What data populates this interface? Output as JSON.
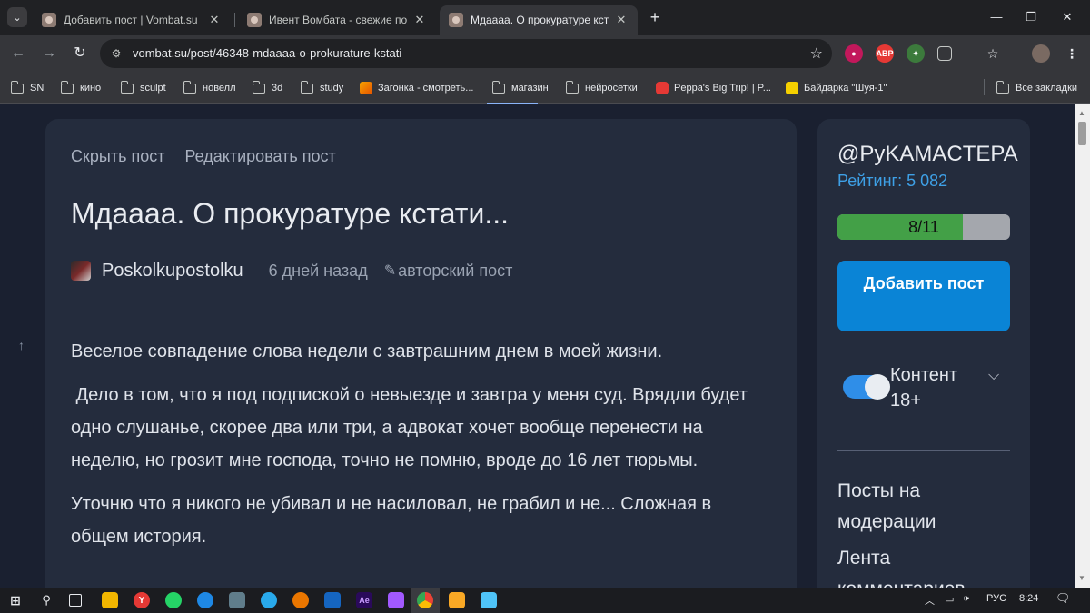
{
  "browser": {
    "tabs": [
      {
        "title": "Добавить пост | Vombat.su",
        "active": false
      },
      {
        "title": "Ивент Вомбата - свежие посты",
        "active": false
      },
      {
        "title": "Мдаааа. О прокуратуре кстати",
        "active": true
      }
    ],
    "url": "vombat.su/post/46348-mdaaaa-o-prokurature-kstati",
    "bookmarks": [
      "SN",
      "кино",
      "sculpt",
      "новелл",
      "3d",
      "study",
      "Загонка - смотреть...",
      "магазин",
      "нейросетки",
      "Peppa's Big Trip! | P...",
      "Байдарка \"Шуя-1\""
    ],
    "all_bookmarks": "Все закладки",
    "extensions": {
      "abp": "ABP"
    }
  },
  "post": {
    "hide_label": "Скрыть пост",
    "edit_label": "Редактировать пост",
    "title": "Мдаааа. О прокуратуре кстати...",
    "author": "Poskolkupostolku",
    "time": "6 дней назад",
    "kind": "авторский пост",
    "paragraphs": [
      "Веселое совпадение слова недели с завтрашним днем в моей жизни.",
      " Дело в том, что я под подпиской о невыезде и завтра у меня суд. Врядли будет одно слушанье, скорее два или три, а адвокат хочет вообще перенести на неделю, но грозит мне господа, точно не помню, вроде до 16 лет тюрьмы.",
      "Уточню что я никого не убивал и не насиловал, не грабил и не... Сложная в общем история."
    ]
  },
  "sidebar": {
    "username": "@PуKAMACTEPA",
    "rating": "Рейтинг: 5 082",
    "progress_text": "8/11",
    "progress_fraction": 0.727,
    "add_button": "Добавить пост",
    "toggle_label": "Контент 18+",
    "toggle_on": true,
    "links": [
      "Посты на модерации",
      "Лента комментариев"
    ]
  },
  "taskbar": {
    "lang": "РУС",
    "time": "8:24"
  },
  "colors": {
    "accent": "#0a84d6",
    "rating": "#3ea0e6",
    "progress": "#43a047",
    "card": "#242c3d",
    "page": "#1a2030"
  }
}
